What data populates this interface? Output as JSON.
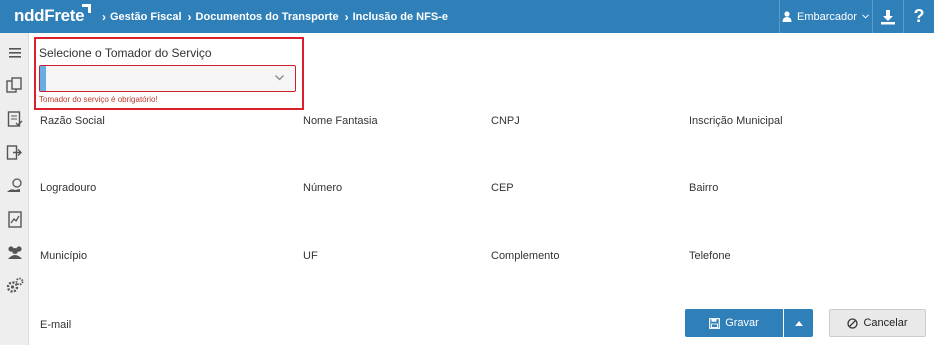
{
  "header": {
    "logo": "nddFrete",
    "breadcrumbs": [
      "Gestão Fiscal",
      "Documentos do Transporte",
      "Inclusão de NFS-e"
    ],
    "user": "Embarcador"
  },
  "sidebar": {
    "icons": [
      "menu-icon",
      "documents-icon",
      "checklist-icon",
      "export-icon",
      "payment-icon",
      "report-icon",
      "users-icon",
      "settings-icon"
    ]
  },
  "form": {
    "tomador_label": "Selecione o Tomador do Serviço",
    "tomador_value": "",
    "tomador_error": "Tomador do serviço é obrigatório!",
    "fields": {
      "razao_social": "Razão Social",
      "nome_fantasia": "Nome Fantasia",
      "cnpj": "CNPJ",
      "inscricao_municipal": "Inscrição Municipal",
      "logradouro": "Logradouro",
      "numero": "Número",
      "cep": "CEP",
      "bairro": "Bairro",
      "municipio": "Município",
      "uf": "UF",
      "complemento": "Complemento",
      "telefone": "Telefone",
      "email": "E-mail"
    }
  },
  "actions": {
    "save": "Gravar",
    "cancel": "Cancelar"
  },
  "colors": {
    "primary": "#2f7fb8",
    "error": "#d9202b",
    "sidebar_bg": "#eeeeee"
  }
}
